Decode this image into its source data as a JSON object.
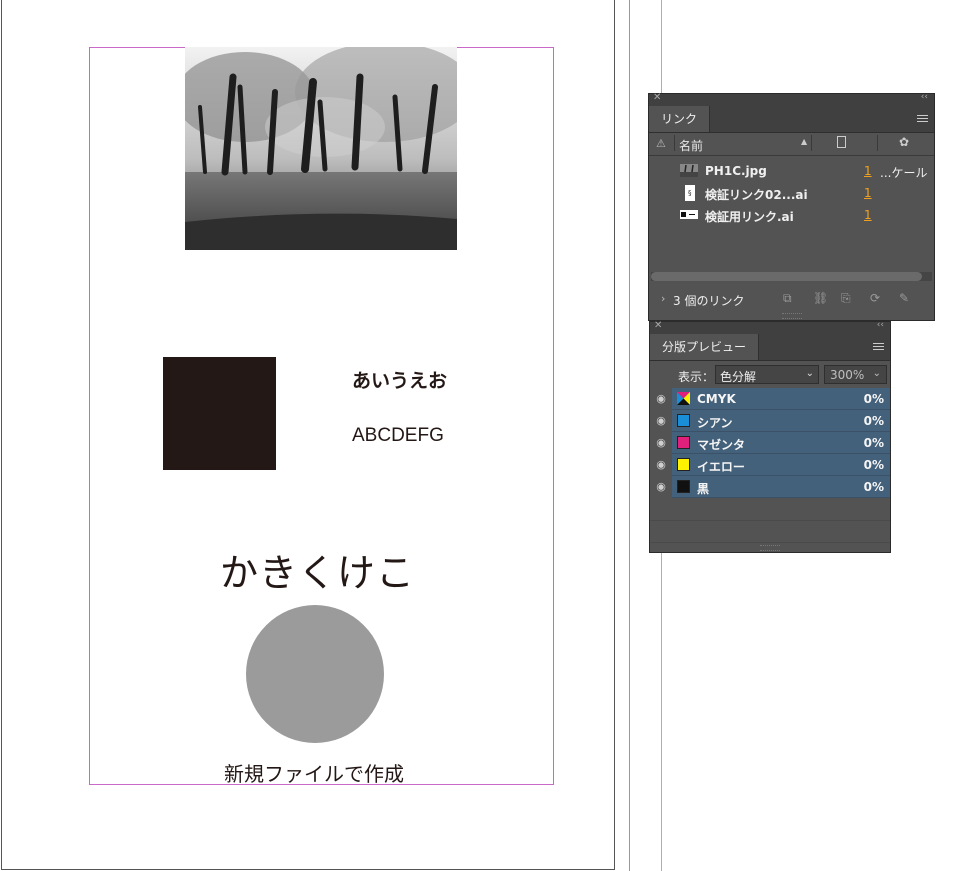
{
  "document": {
    "text_hiragana": "あいうえお",
    "text_alpha": "ABCDEFG",
    "text_kakikukeko": "かきくけこ",
    "text_caption": "新規ファイルで作成",
    "colors": {
      "black_square": "#231815",
      "circle": "#9b9b9b",
      "margin_guide": "#c96ac9",
      "cyan_guide": "#6ec6d8"
    }
  },
  "links_panel": {
    "tab_label": "リンク",
    "column_name": "名前",
    "rows": [
      {
        "name": "PH1C.jpg",
        "page": "1",
        "extra": "...ケール",
        "thumb": "photo-thumbnail"
      },
      {
        "name": "検証リンク02...ai",
        "page": "1",
        "extra": "",
        "thumb": "document-thumbnail"
      },
      {
        "name": "検証用リンク.ai",
        "page": "1",
        "extra": "",
        "thumb": "artwork-thumbnail"
      }
    ],
    "footer_count": "3 個のリンク"
  },
  "separations_panel": {
    "tab_label": "分版プレビュー",
    "view_label": "表示：",
    "view_value": "色分解",
    "zoom_value": "300%",
    "rows": [
      {
        "name": "CMYK",
        "pct": "0%",
        "color": "cmyk"
      },
      {
        "name": "シアン",
        "pct": "0%",
        "color": "#1a8fd8"
      },
      {
        "name": "マゼンタ",
        "pct": "0%",
        "color": "#e0207a"
      },
      {
        "name": "イエロー",
        "pct": "0%",
        "color": "#fff200"
      },
      {
        "name": "黒",
        "pct": "0%",
        "color": "#111111"
      }
    ]
  }
}
